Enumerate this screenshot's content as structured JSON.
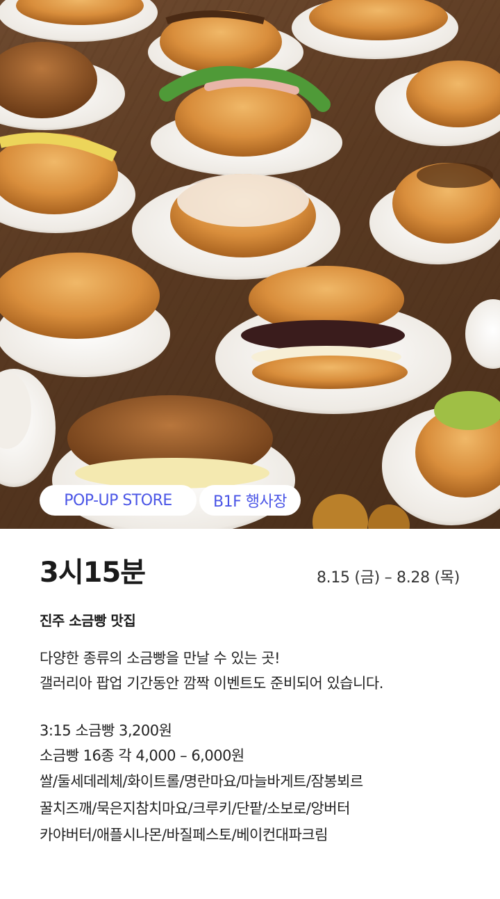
{
  "hero": {
    "tags": {
      "popup": "POP-UP STORE",
      "floor": "B1F 행사장"
    }
  },
  "store": {
    "name": "3시15분",
    "dates": "8.15 (금) – 8.28 (목)",
    "subtitle": "진주 소금빵 맛집",
    "description": [
      "다양한 종류의 소금빵을 만날 수 있는 곳!",
      "갤러리아 팝업 기간동안 깜짝 이벤트도 준비되어 있습니다."
    ],
    "prices": [
      "3:15 소금빵  3,200원",
      "소금빵 16종  각 4,000 – 6,000원"
    ],
    "menu": [
      "쌀/둘세데레체/화이트롤/명란마요/마늘바게트/잠봉뵈르",
      "꿀치즈깨/묵은지참치마요/크루키/단팥/소보로/앙버터",
      "카야버터/애플시나몬/바질페스토/베이컨대파크림"
    ]
  },
  "colors": {
    "accent": "#4a55e6",
    "table_wood": "#5a3a22",
    "plate": "#f4f1ec",
    "bread": "#d9913e"
  }
}
